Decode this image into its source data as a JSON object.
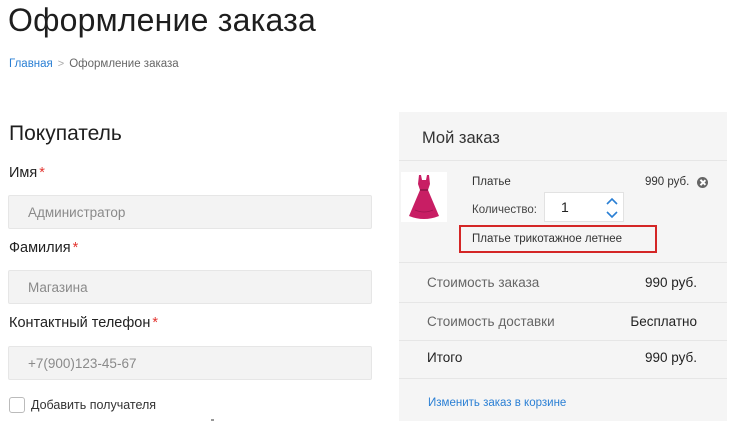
{
  "page": {
    "title": "Оформление заказа"
  },
  "breadcrumb": {
    "home": "Главная",
    "separator": ">",
    "current": "Оформление заказа"
  },
  "buyer": {
    "title": "Покупатель",
    "required_mark": "*",
    "first_name": {
      "label": "Имя",
      "placeholder": "Администратор"
    },
    "last_name": {
      "label": "Фамилия",
      "placeholder": "Магазина"
    },
    "phone": {
      "label": "Контактный телефон",
      "placeholder": "+7(900)123-45-67"
    },
    "add_recipient_label": "Добавить получателя"
  },
  "order": {
    "title": "Мой заказ",
    "item": {
      "name": "Платье",
      "price": "990 руб.",
      "quantity_label": "Количество:",
      "quantity": "1",
      "variant": "Платье трикотажное летнее",
      "thumbnail_icon": "dress-icon",
      "remove_icon": "close-circle-icon"
    },
    "summary": {
      "subtotal_label": "Стоимость заказа",
      "subtotal_value": "990 руб.",
      "delivery_label": "Стоимость доставки",
      "delivery_value": "Бесплатно",
      "total_label": "Итого",
      "total_value": "990 руб."
    },
    "edit_link": "Изменить заказ в корзине"
  },
  "colors": {
    "accent": "#2a7fd4",
    "required": "#e3342f",
    "highlight_border": "#d42626",
    "dress": "#c81e64"
  }
}
